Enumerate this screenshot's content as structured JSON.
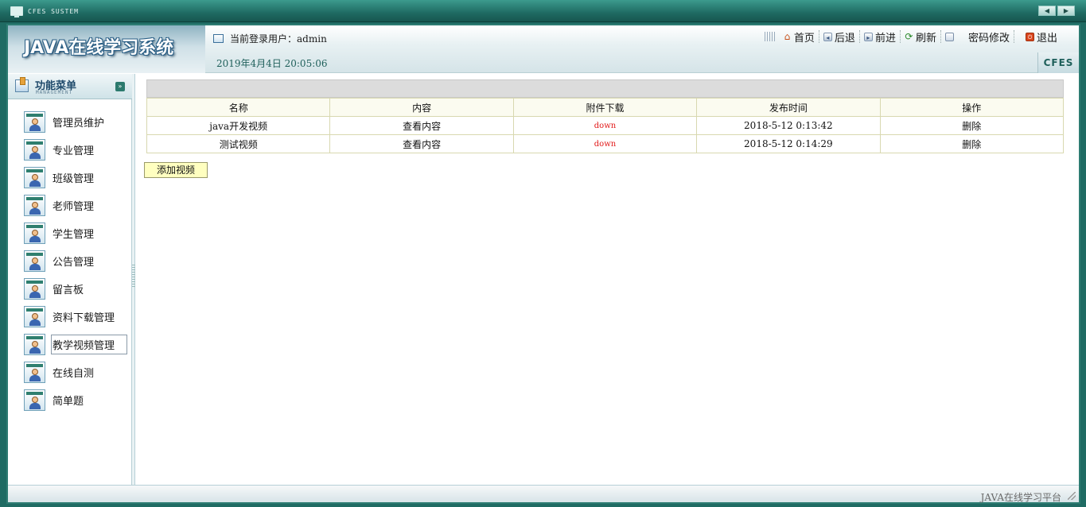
{
  "window": {
    "title": "CFES SUSTEM",
    "btn_prev": "◀",
    "btn_next": "▶"
  },
  "header": {
    "logo": "JAVA在线学习系统",
    "user_prefix": "当前登录用户：",
    "username": "admin",
    "date": "2019年4月4日  20:05:06",
    "cfes": "CFES",
    "nav": {
      "home": "首页",
      "back": "后退",
      "forward": "前进",
      "refresh": "刷新",
      "password": "密码修改",
      "exit": "退出"
    }
  },
  "sidebar": {
    "title": "功能菜单",
    "subtitle": "MANAGEMENT",
    "items": [
      {
        "label": "管理员维护"
      },
      {
        "label": "专业管理"
      },
      {
        "label": "班级管理"
      },
      {
        "label": "老师管理"
      },
      {
        "label": "学生管理"
      },
      {
        "label": "公告管理"
      },
      {
        "label": "留言板"
      },
      {
        "label": "资料下载管理"
      },
      {
        "label": "教学视频管理"
      },
      {
        "label": "在线自测"
      },
      {
        "label": "简单题"
      }
    ],
    "active_index": 8
  },
  "table": {
    "columns": [
      "名称",
      "内容",
      "附件下载",
      "发布时间",
      "操作"
    ],
    "rows": [
      {
        "name": "java开发视频",
        "content": "查看内容",
        "attachment": "down",
        "published": "2018-5-12 0:13:42",
        "action": "删除"
      },
      {
        "name": "测试视频",
        "content": "查看内容",
        "attachment": "down",
        "published": "2018-5-12 0:14:29",
        "action": "删除"
      }
    ]
  },
  "add_button": "添加视频",
  "footer": {
    "text": "JAVA在线学习平台"
  }
}
